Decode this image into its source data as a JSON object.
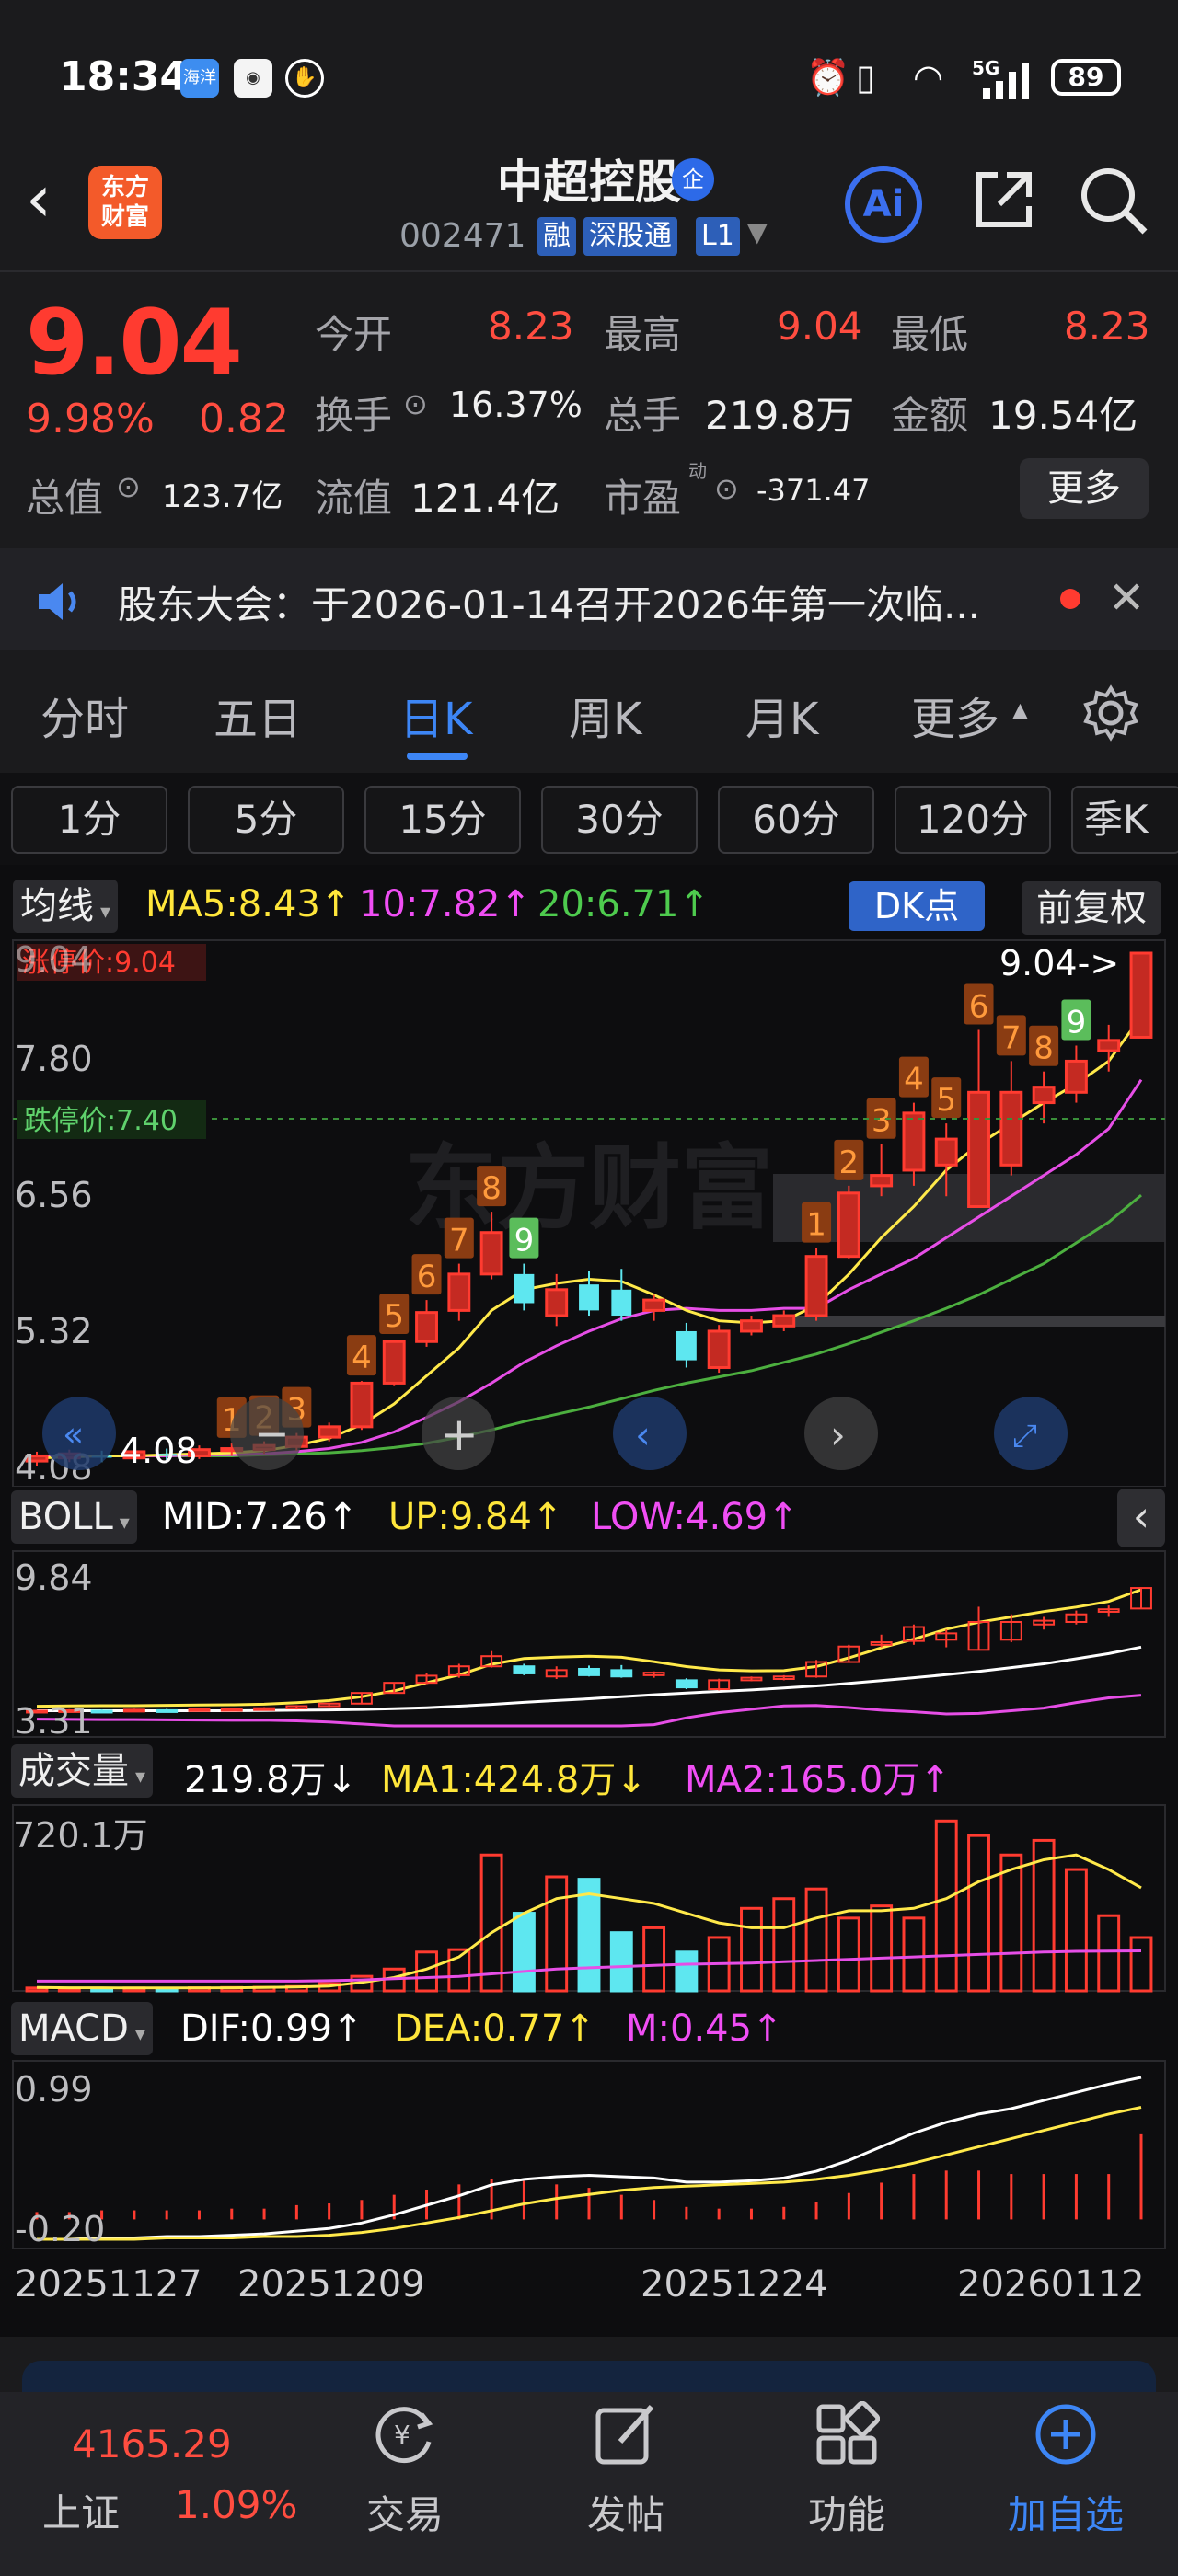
{
  "status_bar": {
    "time": "18:34",
    "apps": [
      "海洋",
      "",
      ""
    ],
    "network": "5G",
    "battery": "89"
  },
  "header": {
    "logo_line1": "东方",
    "logo_line2": "财富",
    "stock_name": "中超控股",
    "badge": "企",
    "stock_code": "002471",
    "tags": [
      "融",
      "深股通",
      "L1"
    ],
    "ai_label": "Ai"
  },
  "quote": {
    "price": "9.04",
    "change_pct": "9.98%",
    "change_amt": "0.82",
    "rows": [
      [
        {
          "label": "今开",
          "value": "8.23"
        },
        {
          "label": "最高",
          "value": "9.04"
        },
        {
          "label": "最低",
          "value": "8.23"
        }
      ],
      [
        {
          "label": "换手",
          "value": "16.37%"
        },
        {
          "label": "总手",
          "value": "219.8万"
        },
        {
          "label": "金额",
          "value": "19.54亿"
        }
      ],
      [
        {
          "label": "总值",
          "value": "123.7亿"
        },
        {
          "label": "流值",
          "value": "121.4亿"
        },
        {
          "label": "市盈",
          "value": "-371.47"
        }
      ]
    ],
    "pe_superscript": "动",
    "more_label": "更多"
  },
  "notice": {
    "text": "股东大会：于2026-01-14召开2026年第一次临..."
  },
  "tabs": [
    "分时",
    "五日",
    "日K",
    "周K",
    "月K",
    "更多"
  ],
  "active_tab": "日K",
  "periods": [
    "1分",
    "5分",
    "15分",
    "30分",
    "60分",
    "120分",
    "季K"
  ],
  "main_chart": {
    "indicator": "均线",
    "ma5": "MA5:8.43↑",
    "ma10": "10:7.82↑",
    "ma20": "20:6.71↑",
    "dk_label": "DK点",
    "fq_label": "前复权",
    "limit_up": "涨停价:9.04",
    "limit_down": "跌停价:7.40",
    "y_ticks": [
      "9.04",
      "7.80",
      "6.56",
      "5.32",
      "4.08"
    ],
    "latest_marker": "9.04->",
    "low_marker": "4.08",
    "watermark": "东方财富"
  },
  "boll": {
    "name": "BOLL",
    "mid": "MID:7.26↑",
    "up": "UP:9.84↑",
    "low": "LOW:4.69↑",
    "y_top": "9.84",
    "y_bottom": "3.31"
  },
  "volume": {
    "name": "成交量",
    "vol": "219.8万↓",
    "ma1": "MA1:424.8万↓",
    "ma2": "MA2:165.0万↑",
    "y_top": "720.1万"
  },
  "macd": {
    "name": "MACD",
    "dif": "DIF:0.99↑",
    "dea": "DEA:0.77↑",
    "m": "M:0.45↑",
    "y_top": "0.99",
    "y_bottom": "-0.20"
  },
  "x_dates": [
    "20251127",
    "20251209",
    "20251224",
    "20260112"
  ],
  "chart_data": {
    "type": "candlestick",
    "x_labels": [
      "20251127",
      "20251209",
      "20251224",
      "20260112"
    ],
    "ylim": [
      4.08,
      9.04
    ],
    "candles": [
      {
        "o": 4.15,
        "c": 4.2,
        "h": 4.24,
        "l": 4.1
      },
      {
        "o": 4.18,
        "c": 4.22,
        "h": 4.26,
        "l": 4.14
      },
      {
        "o": 4.2,
        "c": 4.19,
        "h": 4.25,
        "l": 4.14
      },
      {
        "o": 4.18,
        "c": 4.24,
        "h": 4.28,
        "l": 4.15
      },
      {
        "o": 4.22,
        "c": 4.2,
        "h": 4.27,
        "l": 4.16
      },
      {
        "o": 4.2,
        "c": 4.26,
        "h": 4.3,
        "l": 4.17
      },
      {
        "o": 4.25,
        "c": 4.27,
        "h": 4.32,
        "l": 4.2
      },
      {
        "o": 4.26,
        "c": 4.3,
        "h": 4.34,
        "l": 4.22
      },
      {
        "o": 4.29,
        "c": 4.38,
        "h": 4.42,
        "l": 4.25
      },
      {
        "o": 4.38,
        "c": 4.48,
        "h": 4.52,
        "l": 4.34
      },
      {
        "o": 4.48,
        "c": 4.9,
        "h": 4.92,
        "l": 4.45
      },
      {
        "o": 4.9,
        "c": 5.3,
        "h": 5.32,
        "l": 4.88
      },
      {
        "o": 5.3,
        "c": 5.58,
        "h": 5.7,
        "l": 5.25
      },
      {
        "o": 5.6,
        "c": 5.95,
        "h": 6.05,
        "l": 5.5
      },
      {
        "o": 5.95,
        "c": 6.35,
        "h": 6.55,
        "l": 5.9
      },
      {
        "o": 5.95,
        "c": 5.67,
        "h": 6.05,
        "l": 5.6
      },
      {
        "o": 5.55,
        "c": 5.8,
        "h": 5.95,
        "l": 5.45
      },
      {
        "o": 5.85,
        "c": 5.6,
        "h": 5.98,
        "l": 5.55
      },
      {
        "o": 5.8,
        "c": 5.55,
        "h": 6.0,
        "l": 5.5
      },
      {
        "o": 5.6,
        "c": 5.7,
        "h": 5.75,
        "l": 5.5
      },
      {
        "o": 5.4,
        "c": 5.12,
        "h": 5.48,
        "l": 5.05
      },
      {
        "o": 5.05,
        "c": 5.4,
        "h": 5.46,
        "l": 5.0
      },
      {
        "o": 5.4,
        "c": 5.5,
        "h": 5.55,
        "l": 5.36
      },
      {
        "o": 5.45,
        "c": 5.55,
        "h": 5.6,
        "l": 5.4
      },
      {
        "o": 5.55,
        "c": 6.12,
        "h": 6.2,
        "l": 5.5
      },
      {
        "o": 6.12,
        "c": 6.73,
        "h": 6.8,
        "l": 6.1
      },
      {
        "o": 6.8,
        "c": 6.9,
        "h": 7.2,
        "l": 6.7
      },
      {
        "o": 6.95,
        "c": 7.5,
        "h": 7.6,
        "l": 6.8
      },
      {
        "o": 7.0,
        "c": 7.25,
        "h": 7.4,
        "l": 6.7
      },
      {
        "o": 6.6,
        "c": 7.7,
        "h": 8.3,
        "l": 6.6
      },
      {
        "o": 7.0,
        "c": 7.7,
        "h": 8.0,
        "l": 6.9
      },
      {
        "o": 7.6,
        "c": 7.75,
        "h": 7.9,
        "l": 7.4
      },
      {
        "o": 7.7,
        "c": 8.0,
        "h": 8.15,
        "l": 7.6
      },
      {
        "o": 8.1,
        "c": 8.2,
        "h": 8.35,
        "l": 7.9
      },
      {
        "o": 8.23,
        "c": 9.04,
        "h": 9.04,
        "l": 8.23
      }
    ],
    "ma5": [
      4.18,
      4.19,
      4.2,
      4.2,
      4.21,
      4.22,
      4.23,
      4.25,
      4.3,
      4.37,
      4.5,
      4.7,
      4.97,
      5.24,
      5.6,
      5.8,
      5.86,
      5.9,
      5.88,
      5.75,
      5.6,
      5.5,
      5.48,
      5.5,
      5.65,
      5.95,
      6.3,
      6.6,
      6.95,
      7.2,
      7.4,
      7.6,
      7.78,
      8.0,
      8.43
    ],
    "ma10": [
      4.2,
      4.2,
      4.2,
      4.2,
      4.2,
      4.21,
      4.21,
      4.22,
      4.24,
      4.27,
      4.33,
      4.43,
      4.57,
      4.72,
      4.9,
      5.1,
      5.26,
      5.4,
      5.52,
      5.6,
      5.62,
      5.6,
      5.6,
      5.62,
      5.62,
      5.8,
      5.95,
      6.1,
      6.3,
      6.5,
      6.7,
      6.9,
      7.1,
      7.35,
      7.82
    ],
    "ma20": [
      4.2,
      4.2,
      4.2,
      4.2,
      4.2,
      4.2,
      4.2,
      4.21,
      4.22,
      4.23,
      4.25,
      4.28,
      4.32,
      4.38,
      4.45,
      4.53,
      4.6,
      4.67,
      4.75,
      4.83,
      4.9,
      4.96,
      5.02,
      5.1,
      5.18,
      5.28,
      5.39,
      5.5,
      5.62,
      5.75,
      5.9,
      6.05,
      6.25,
      6.45,
      6.71
    ],
    "td_marks": [
      {
        "i": 6,
        "n": "1",
        "color": "orange"
      },
      {
        "i": 7,
        "n": "2",
        "color": "orange"
      },
      {
        "i": 8,
        "n": "3",
        "color": "orange"
      },
      {
        "i": 10,
        "n": "4",
        "color": "orange"
      },
      {
        "i": 11,
        "n": "5",
        "color": "orange"
      },
      {
        "i": 12,
        "n": "6",
        "color": "orange"
      },
      {
        "i": 13,
        "n": "7",
        "color": "orange"
      },
      {
        "i": 14,
        "n": "8",
        "color": "orange"
      },
      {
        "i": 15,
        "n": "9",
        "color": "green"
      },
      {
        "i": 24,
        "n": "1",
        "color": "orange"
      },
      {
        "i": 25,
        "n": "2",
        "color": "orange"
      },
      {
        "i": 26,
        "n": "3",
        "color": "orange"
      },
      {
        "i": 27,
        "n": "4",
        "color": "orange"
      },
      {
        "i": 28,
        "n": "5",
        "color": "orange"
      },
      {
        "i": 29,
        "n": "6",
        "color": "orange"
      },
      {
        "i": 30,
        "n": "7",
        "color": "orange"
      },
      {
        "i": 31,
        "n": "8",
        "color": "orange"
      },
      {
        "i": 32,
        "n": "9",
        "color": "green"
      }
    ],
    "volume_wan": [
      12,
      10,
      11,
      12,
      10,
      13,
      14,
      15,
      18,
      30,
      60,
      90,
      160,
      170,
      560,
      320,
      470,
      460,
      240,
      260,
      160,
      220,
      340,
      380,
      420,
      300,
      350,
      300,
      700,
      640,
      560,
      620,
      500,
      310,
      219.8
    ],
    "vol_ma1": [
      14,
      13,
      13,
      12,
      12,
      12,
      13,
      14,
      16,
      20,
      35,
      55,
      90,
      140,
      240,
      320,
      380,
      400,
      380,
      360,
      320,
      280,
      260,
      260,
      300,
      330,
      330,
      340,
      380,
      450,
      500,
      540,
      560,
      500,
      424.8
    ],
    "vol_ma2": [
      40,
      40,
      40,
      40,
      40,
      40,
      40,
      40,
      40,
      42,
      45,
      50,
      55,
      60,
      70,
      80,
      90,
      95,
      100,
      105,
      110,
      112,
      115,
      120,
      125,
      130,
      135,
      140,
      145,
      150,
      155,
      160,
      163,
      164,
      165.0
    ],
    "macd_dif": [
      -0.2,
      -0.2,
      -0.19,
      -0.19,
      -0.18,
      -0.18,
      -0.17,
      -0.16,
      -0.14,
      -0.12,
      -0.08,
      -0.02,
      0.05,
      0.12,
      0.2,
      0.24,
      0.26,
      0.27,
      0.26,
      0.25,
      0.22,
      0.22,
      0.23,
      0.25,
      0.3,
      0.38,
      0.48,
      0.58,
      0.66,
      0.72,
      0.76,
      0.82,
      0.88,
      0.94,
      0.99
    ],
    "macd_dea": [
      -0.2,
      -0.2,
      -0.2,
      -0.2,
      -0.19,
      -0.19,
      -0.19,
      -0.18,
      -0.18,
      -0.17,
      -0.15,
      -0.12,
      -0.08,
      -0.04,
      0.01,
      0.06,
      0.1,
      0.13,
      0.16,
      0.18,
      0.19,
      0.2,
      0.21,
      0.22,
      0.24,
      0.27,
      0.31,
      0.36,
      0.42,
      0.48,
      0.54,
      0.6,
      0.66,
      0.72,
      0.77
    ],
    "macd_m": [
      0.0,
      0.0,
      0.01,
      0.01,
      0.01,
      0.01,
      0.02,
      0.02,
      0.04,
      0.05,
      0.07,
      0.1,
      0.13,
      0.16,
      0.19,
      0.18,
      0.16,
      0.14,
      0.1,
      0.07,
      0.03,
      0.02,
      0.02,
      0.03,
      0.06,
      0.11,
      0.17,
      0.22,
      0.24,
      0.24,
      0.22,
      0.22,
      0.22,
      0.22,
      0.45
    ]
  },
  "bottom_nav": {
    "index_value": "4165.29",
    "index_name": "上证",
    "index_pct": "1.09%",
    "items": [
      "交易",
      "发帖",
      "功能",
      "加自选"
    ]
  },
  "colors": {
    "up": "#ff3b30",
    "down": "#5ee7f0",
    "ma5": "#ffe94a",
    "ma10": "#e64ee6",
    "ma20": "#4caf3f",
    "accent": "#3d86f6"
  }
}
